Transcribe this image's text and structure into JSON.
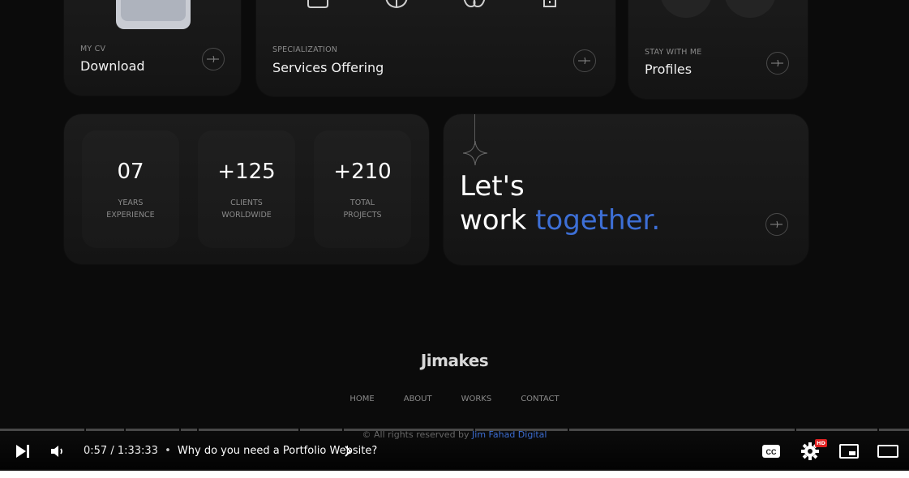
{
  "cards": {
    "cv": {
      "kicker": "MY CV",
      "title": "Download"
    },
    "services": {
      "kicker": "SPECIALIZATION",
      "title": "Services Offering"
    },
    "profiles": {
      "kicker": "STAY WITH ME",
      "title": "Profiles"
    }
  },
  "stats": [
    {
      "value": "07",
      "label_line1": "YEARS",
      "label_line2": "EXPERIENCE"
    },
    {
      "value": "+125",
      "label_line1": "CLIENTS",
      "label_line2": "WORLDWIDE"
    },
    {
      "value": "+210",
      "label_line1": "TOTAL",
      "label_line2": "PROJECTS"
    }
  ],
  "work": {
    "line1": "Let's",
    "line2_plain": "work",
    "line2_accent": "together."
  },
  "footer": {
    "logo": "Jimakes",
    "nav": [
      "HOME",
      "ABOUT",
      "WORKS",
      "CONTACT"
    ],
    "copyright": "© All rights reserved by",
    "brand": "Jim Fahad Digital"
  },
  "player": {
    "time": "0:57 / 1:33:33",
    "separator": "•",
    "chapter": "Why do you need a Portfolio Website?",
    "hd_badge": "HD",
    "progress_fraction": 0.0102,
    "chapter_segments": 12
  },
  "colors": {
    "accent": "#3d6fd6",
    "background": "#0b0b0b",
    "card": "#181818"
  },
  "icons": [
    "next-icon",
    "volume-icon",
    "captions-icon",
    "settings-icon",
    "miniplayer-icon",
    "theater-icon",
    "arrow-circle-icon",
    "star-icon"
  ]
}
